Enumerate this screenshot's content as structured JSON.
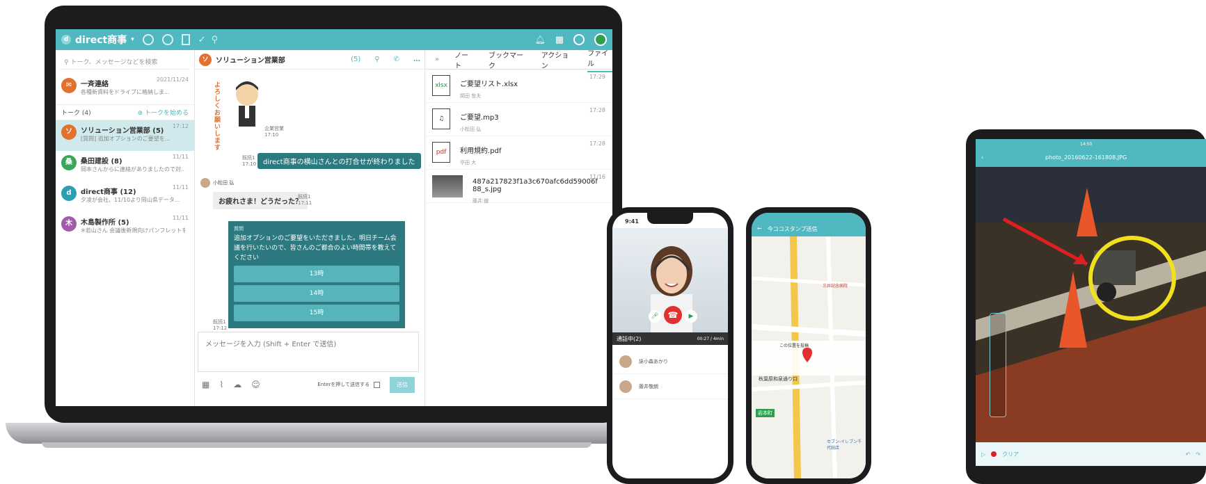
{
  "app": {
    "brand": "direct商事",
    "search_placeholder": "トーク、メッセージなどを検索"
  },
  "sidebar": {
    "broadcast": {
      "name": "一斉連絡",
      "preview": "各種新資料をドライブに格納しま...",
      "time": "2021/11/24"
    },
    "talk_section_label": "トーク (4)",
    "start_talk_label": "トークを始める",
    "talks": [
      {
        "name": "ソリューション営業部 (5)",
        "preview": "[質問] 追加オプションのご要望を...",
        "time": "17:12",
        "color": "#e2702e",
        "initial": "ソ"
      },
      {
        "name": "桑田建設 (8)",
        "preview": "岡本さんからに連絡がありましたので対...",
        "time": "11/11",
        "color": "#3aa65a",
        "initial": "桑"
      },
      {
        "name": "direct商事 (12)",
        "preview": "夕凌が会社、11/10より岡山県データ...",
        "time": "11/11",
        "color": "#2d9fb1",
        "initial": "d"
      },
      {
        "name": "木島製作所 (5)",
        "preview": "※若山さん 会議後新規向けパンフレットを...",
        "time": "11/11",
        "color": "#a05ca8",
        "initial": "木"
      }
    ]
  },
  "chat": {
    "title": "ソリューション営業部",
    "member_count": "(5)",
    "sticker_text": "よろしくお願いします",
    "sticker_sender": "企業営業",
    "sticker_time": "17:10",
    "msg1": {
      "text": "direct商事の横山さんとの打合せが終わりました",
      "meta": "既読1",
      "time": "17:10"
    },
    "msg2_sender": "小松田 弘",
    "msg2": {
      "text": "お疲れさま！どうだった？",
      "meta": "既読1",
      "time": "17:11"
    },
    "question_label": "質問",
    "question_text": "追加オプションのご要望をいただきました。明日チーム会議を行いたいので、皆さんのご都合のよい時間帯を教えてください",
    "options": [
      "13時",
      "14時",
      "15時"
    ],
    "question_meta": "既読1",
    "question_time": "17:12",
    "input_placeholder": "メッセージを入力 (Shift + Enter で送信)",
    "enter_send_label": "Enterを押して送信する",
    "send_label": "送信"
  },
  "files": {
    "tabs": [
      "ノート",
      "ブックマーク",
      "アクション",
      "ファイル"
    ],
    "items": [
      {
        "icon": "xlsx",
        "name": "ご要望リスト.xlsx",
        "owner": "岡田 哲夫",
        "time": "17:29"
      },
      {
        "icon": "♫",
        "name": "ご要望.mp3",
        "owner": "小松田 弘",
        "time": "17:28"
      },
      {
        "icon": "pdf",
        "name": "利用規約.pdf",
        "owner": "亭田 大",
        "time": "17:28"
      },
      {
        "icon": "img",
        "name": "487a217823f1a3c670afc6dd59006f88_s.jpg",
        "owner": "藤井 徹",
        "time": "11/16"
      }
    ]
  },
  "phone1": {
    "time": "9:41",
    "call_status": "通話中(2)",
    "call_timer": "00:27 / 4min",
    "participants": [
      "詠小森あかり",
      "藤井敬朗"
    ]
  },
  "phone2": {
    "title": "今ココスタンプ送信",
    "station": "岩本町",
    "hospital": "三井記念病院",
    "seven": "セブン-イレブン千代田店",
    "address_label": "この位置を投稿",
    "bottom": "秋葉原和泉通り口"
  },
  "tablet": {
    "filename": "photo_20160622-161808.JPG",
    "time": "14:50",
    "clear_label": "クリア"
  },
  "colors": {
    "accent": "#4fb8c0",
    "dark_bubble": "#2c7a80"
  }
}
